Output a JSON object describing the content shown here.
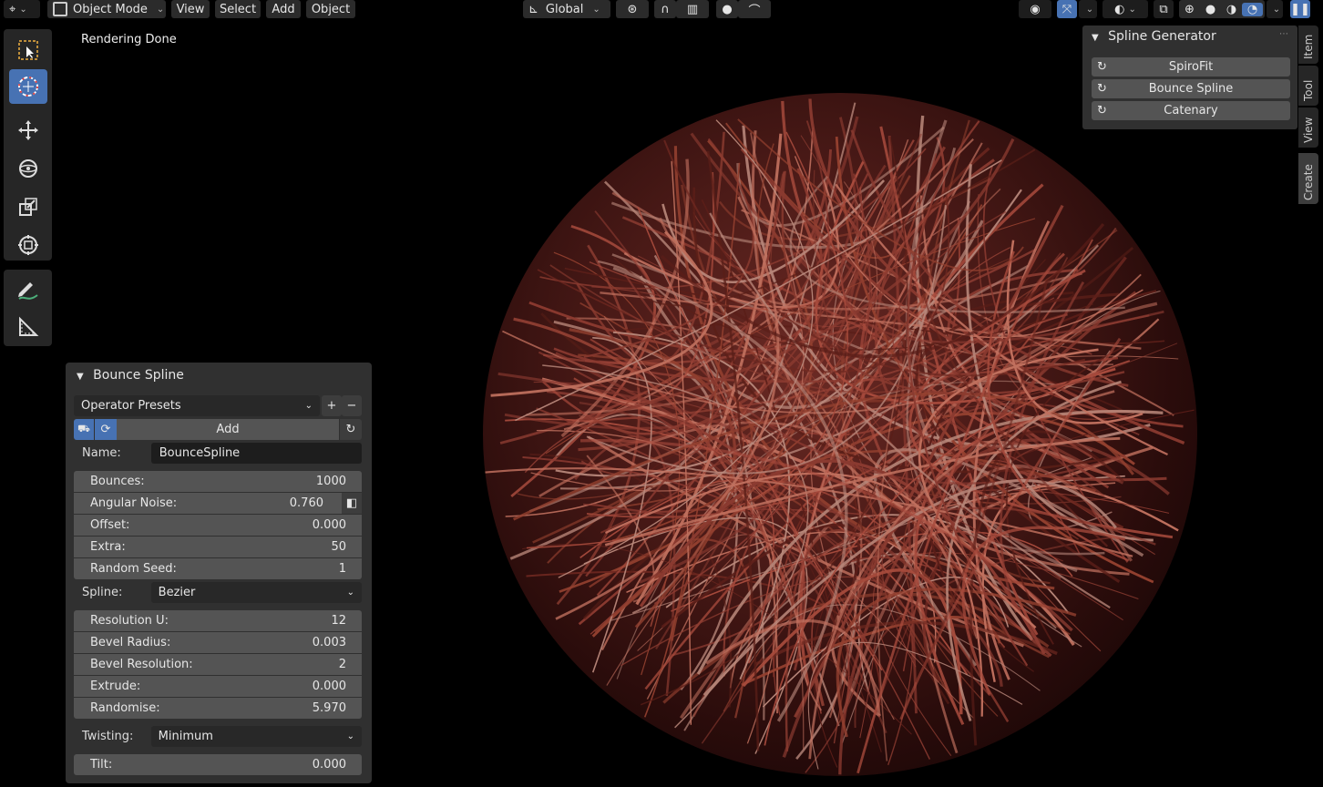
{
  "header": {
    "mode": "Object Mode",
    "menus": [
      "View",
      "Select",
      "Add",
      "Object"
    ],
    "orientation": "Global"
  },
  "status_text": "Rendering Done",
  "operator_panel": {
    "title": "Bounce Spline",
    "presets": "Operator Presets",
    "add_label": "Add",
    "name_label": "Name:",
    "name_value": "BounceSpline",
    "group1": [
      {
        "label": "Bounces:",
        "value": "1000"
      },
      {
        "label": "Angular Noise:",
        "value": "0.760"
      },
      {
        "label": "Offset:",
        "value": "0.000"
      },
      {
        "label": "Extra:",
        "value": "50"
      },
      {
        "label": "Random Seed:",
        "value": "1"
      }
    ],
    "spline_label": "Spline:",
    "spline_value": "Bezier",
    "group2": [
      {
        "label": "Resolution U:",
        "value": "12"
      },
      {
        "label": "Bevel Radius:",
        "value": "0.003"
      },
      {
        "label": "Bevel Resolution:",
        "value": "2"
      },
      {
        "label": "Extrude:",
        "value": "0.000"
      },
      {
        "label": "Randomise:",
        "value": "5.970"
      }
    ],
    "twisting_label": "Twisting:",
    "twisting_value": "Minimum",
    "tilt_label": "Tilt:",
    "tilt_value": "0.000"
  },
  "sidebar": {
    "title": "Spline Generator",
    "buttons": [
      "SpiroFit",
      "Bounce Spline",
      "Catenary"
    ],
    "tabs": [
      "Item",
      "Tool",
      "View",
      "Create"
    ]
  },
  "colors": {
    "accent": "#4772b3",
    "panel": "#303030",
    "field": "#545454"
  }
}
